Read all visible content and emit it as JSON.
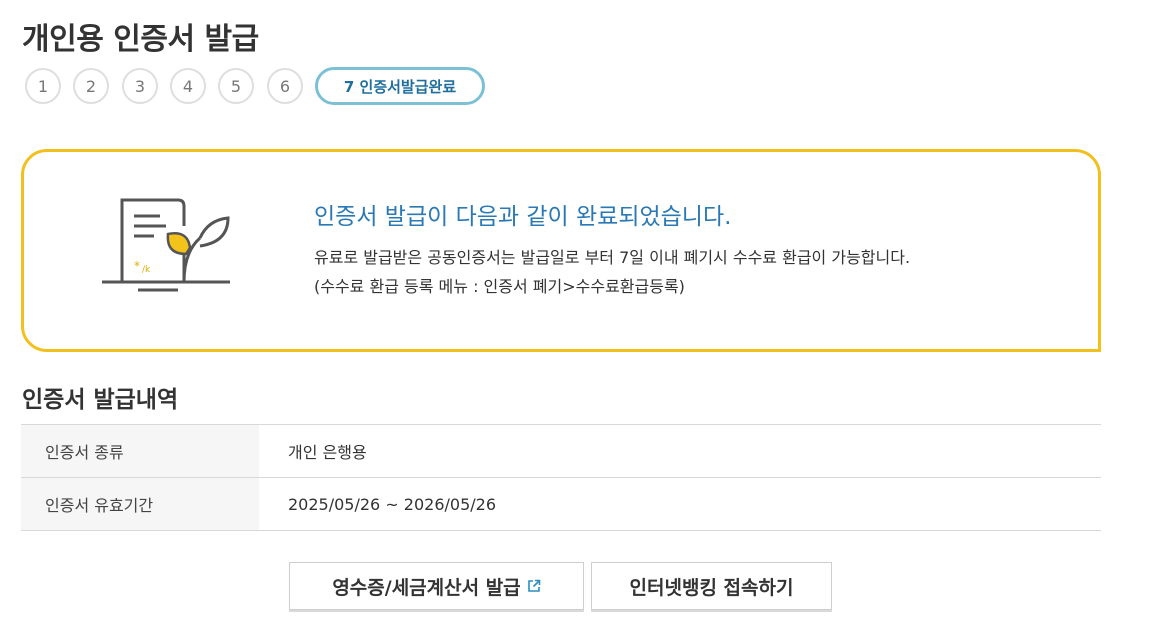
{
  "page": {
    "title": "개인용 인증서 발급"
  },
  "steps": {
    "items": [
      "1",
      "2",
      "3",
      "4",
      "5",
      "6"
    ],
    "active_label": "7 인증서발급완료"
  },
  "notice": {
    "heading": "인증서 발급이 다음과 같이 완료되었습니다.",
    "line1": "유료로 발급받은 공동인증서는 발급일로 부터 7일 이내 폐기시 수수료 환급이 가능합니다.",
    "line2": "(수수료 환급 등록 메뉴 : 인증서 폐기>수수료환급등록)",
    "accent_color": "#f2c01e",
    "heading_color": "#2a79b5",
    "icon": "certificate-plant-icon"
  },
  "history": {
    "title": "인증서 발급내역",
    "rows": [
      {
        "label": "인증서 종류",
        "value": "개인 은행용"
      },
      {
        "label": "인증서 유효기간",
        "value": "2025/05/26 ~ 2026/05/26"
      }
    ]
  },
  "buttons": {
    "receipt_label": "영수증/세금계산서 발급",
    "receipt_icon": "external-link-icon",
    "bank_label": "인터넷뱅킹 접속하기"
  }
}
